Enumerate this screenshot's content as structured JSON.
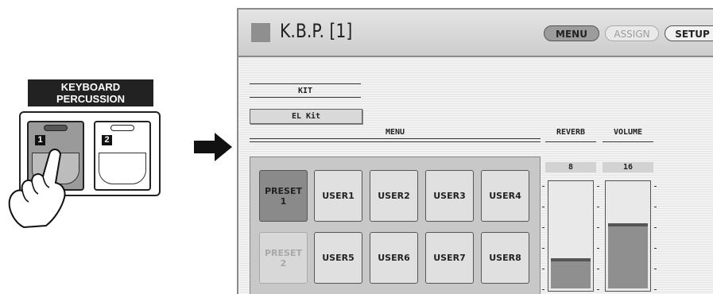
{
  "panel": {
    "label_line1": "KEYBOARD",
    "label_line2": "PERCUSSION",
    "buttons": [
      {
        "number": "1",
        "lit": true
      },
      {
        "number": "2",
        "lit": false
      }
    ]
  },
  "screen": {
    "title": "K.B.P. [1]",
    "top_buttons": {
      "menu": "MENU",
      "assign": "ASSIGN",
      "setup": "SETUP"
    },
    "kit": {
      "label": "KIT",
      "value": "EL Kit"
    },
    "menu_label": "MENU",
    "menu_buttons": {
      "preset1_line1": "PRESET",
      "preset1_line2": "1",
      "preset2_line1": "PRESET",
      "preset2_line2": "2",
      "user1": "USER1",
      "user2": "USER2",
      "user3": "USER3",
      "user4": "USER4",
      "user5": "USER5",
      "user6": "USER6",
      "user7": "USER7",
      "user8": "USER8"
    },
    "reverb": {
      "label": "REVERB",
      "value": "8",
      "level": 0.27
    },
    "volume": {
      "label": "VOLUME",
      "value": "16",
      "level": 0.6
    }
  },
  "colors": {
    "selected": "#8a8a8a",
    "display_bg": "#eeeeee"
  }
}
